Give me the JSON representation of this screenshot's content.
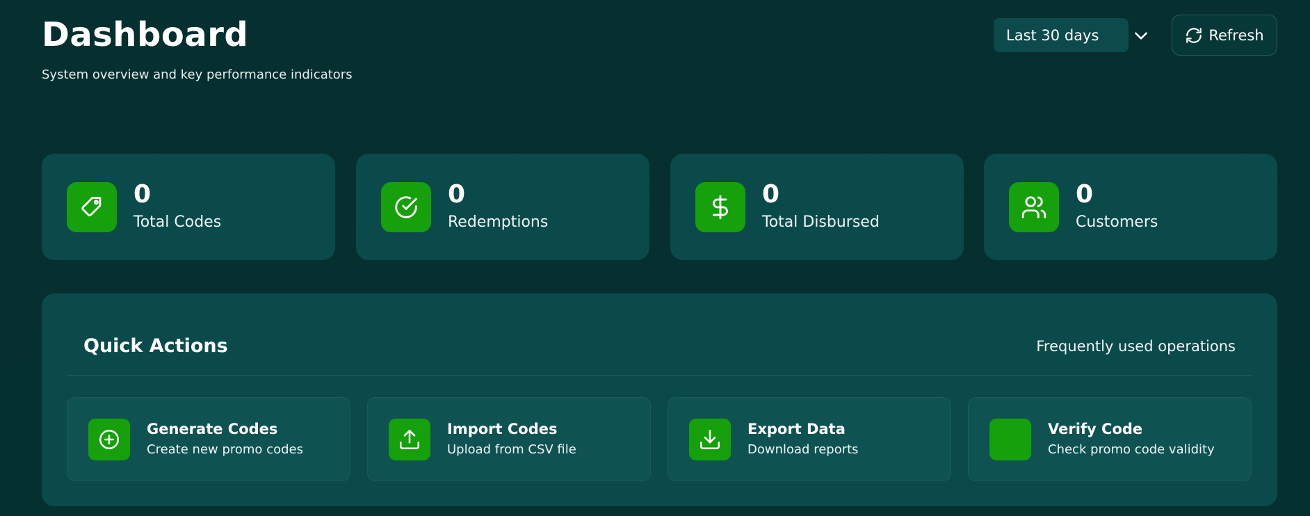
{
  "header": {
    "title": "Dashboard",
    "subtitle": "System overview and key performance indicators",
    "date_range": {
      "selected": "Last 30 days"
    },
    "refresh_label": "Refresh"
  },
  "stats": [
    {
      "value": "0",
      "label": "Total Codes",
      "icon": "tag-icon"
    },
    {
      "value": "0",
      "label": "Redemptions",
      "icon": "check-circle-icon"
    },
    {
      "value": "0",
      "label": "Total Disbursed",
      "icon": "dollar-icon"
    },
    {
      "value": "0",
      "label": "Customers",
      "icon": "users-icon"
    }
  ],
  "quick_actions": {
    "title": "Quick Actions",
    "subtitle": "Frequently used operations",
    "items": [
      {
        "title": "Generate Codes",
        "description": "Create new promo codes",
        "icon": "plus-circle-icon"
      },
      {
        "title": "Import Codes",
        "description": "Upload from CSV file",
        "icon": "upload-icon"
      },
      {
        "title": "Export Data",
        "description": "Download reports",
        "icon": "download-icon"
      },
      {
        "title": "Verify Code",
        "description": "Check promo code validity",
        "icon": "verify-icon"
      }
    ]
  },
  "colors": {
    "background": "#062f2f",
    "card": "#0b4a4b",
    "accent_green": "#16a00c",
    "text": "#ffffff"
  }
}
